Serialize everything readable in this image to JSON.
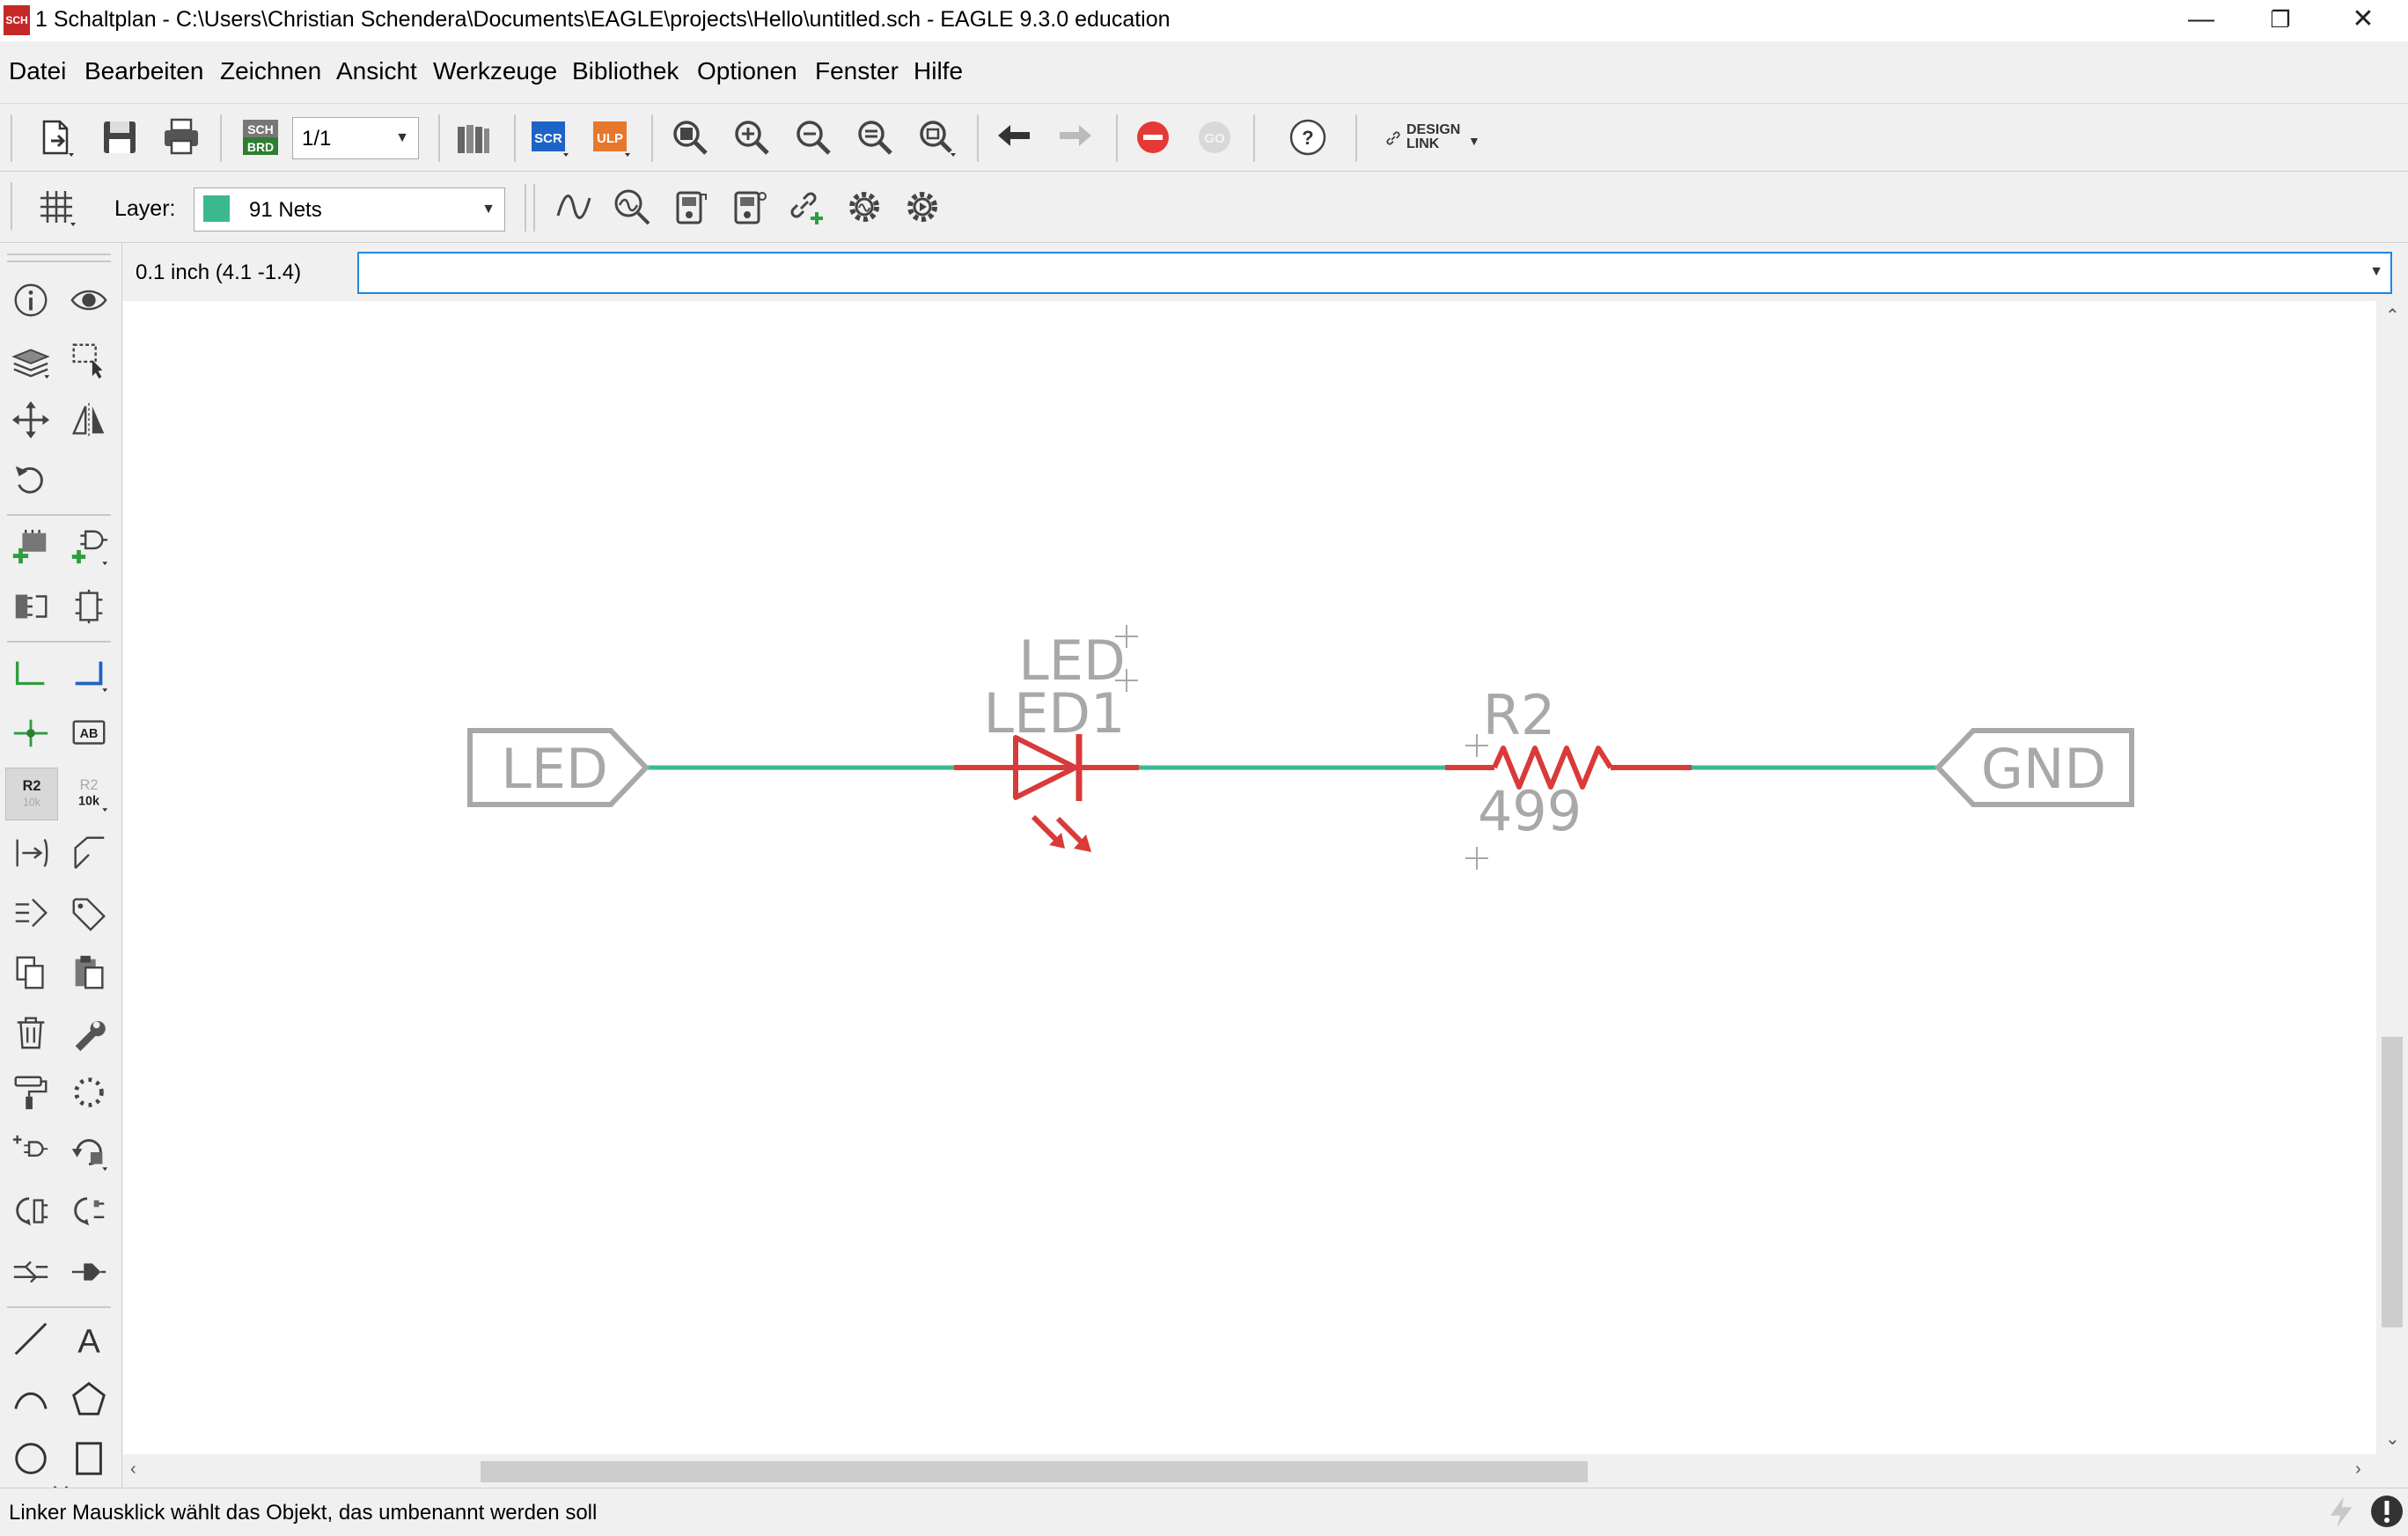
{
  "window": {
    "app_icon_text": "SCH",
    "title": "1 Schaltplan - C:\\Users\\Christian Schendera\\Documents\\EAGLE\\projects\\Hello\\untitled.sch - EAGLE 9.3.0 education",
    "minimize": "—",
    "restore": "❐",
    "close": "✕"
  },
  "menu": [
    "Datei",
    "Bearbeiten",
    "Zeichnen",
    "Ansicht",
    "Werkzeuge",
    "Bibliothek",
    "Optionen",
    "Fenster",
    "Hilfe"
  ],
  "toolbar": {
    "sheet_select": "1/1",
    "scr_label": "SCR",
    "ulp_label": "ULP",
    "go_label": "GO",
    "help_label": "?",
    "design_link_line1": "DESIGN",
    "design_link_line2": "LINK"
  },
  "layerbar": {
    "layer_label": "Layer:",
    "layer_value": "91 Nets",
    "layer_color": "#3cb890"
  },
  "palette": {
    "name_icon_top": "R2",
    "name_icon_sub": "10k",
    "value_icon_top": "R2",
    "value_icon_sub": "10k",
    "label_icon": "AB",
    "text_icon": "A"
  },
  "command": {
    "coordinates": "0.1 inch (4.1 -1.4)",
    "input_value": ""
  },
  "schematic": {
    "label_left": "LED",
    "label_right": "GND",
    "led_name": "LED1",
    "led_value": "LED",
    "resistor_name": "R2",
    "resistor_value": "499",
    "colors": {
      "net": "#3cb890",
      "part": "#d93a3a",
      "text": "#a8a8a8"
    }
  },
  "status": {
    "message": "Linker Mausklick wählt das Objekt, das umbenannt werden soll"
  }
}
